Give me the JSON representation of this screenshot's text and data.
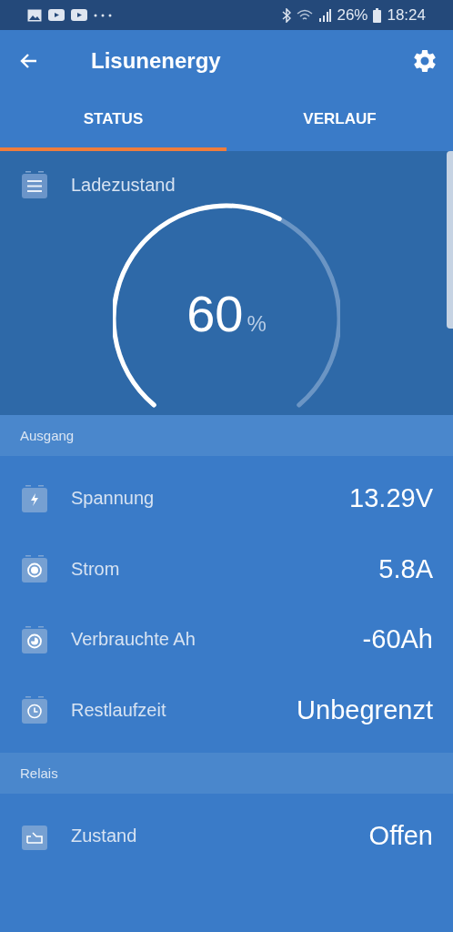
{
  "status_bar": {
    "battery": "26%",
    "time": "18:24"
  },
  "app_bar": {
    "title": "Lisunenergy"
  },
  "tabs": [
    {
      "label": "STATUS",
      "selected": true
    },
    {
      "label": "VERLAUF",
      "selected": false
    }
  ],
  "gauge": {
    "label": "Ladezustand",
    "value": "60",
    "unit": "%"
  },
  "sections": [
    {
      "title": "Ausgang",
      "rows": [
        {
          "kind": "voltage",
          "label": "Spannung",
          "value": "13.29V"
        },
        {
          "kind": "current",
          "label": "Strom",
          "value": "5.8A"
        },
        {
          "kind": "consumed",
          "label": "Verbrauchte Ah",
          "value": "-60Ah"
        },
        {
          "kind": "time",
          "label": "Restlaufzeit",
          "value": "Unbegrenzt"
        }
      ]
    },
    {
      "title": "Relais",
      "rows": [
        {
          "kind": "relay",
          "label": "Zustand",
          "value": "Offen"
        }
      ]
    }
  ]
}
